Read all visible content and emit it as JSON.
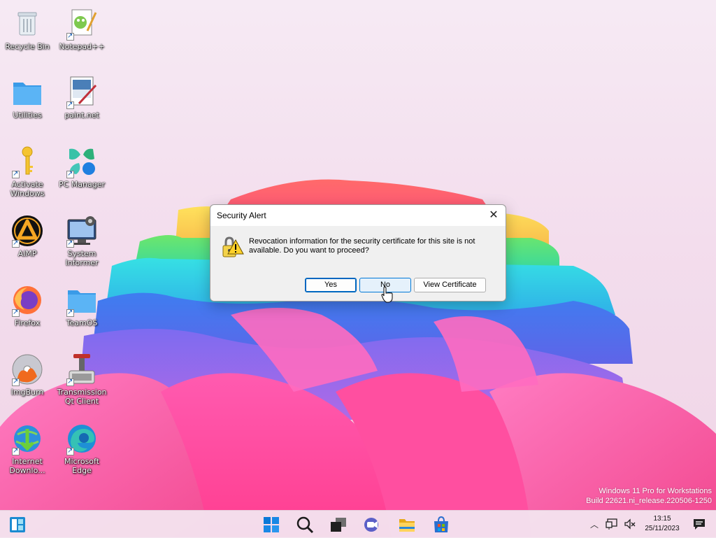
{
  "desktop": {
    "icons": [
      {
        "label": "Recycle Bin"
      },
      {
        "label": "Notepad++"
      },
      {
        "label": "Utilities"
      },
      {
        "label": "paint.net"
      },
      {
        "label": "Activate Windows"
      },
      {
        "label": "PC Manager"
      },
      {
        "label": "AIMP"
      },
      {
        "label": "System Informer"
      },
      {
        "label": "Firefox"
      },
      {
        "label": "TeamOS"
      },
      {
        "label": "ImgBurn"
      },
      {
        "label": "Transmission Qt Client"
      },
      {
        "label": "Internet Downlo..."
      },
      {
        "label": "Microsoft Edge"
      }
    ]
  },
  "dialog": {
    "title": "Security Alert",
    "message": "Revocation information for the security certificate for this site is not available. Do you want to proceed?",
    "buttons": {
      "yes": "Yes",
      "no": "No",
      "view_certificate": "View Certificate"
    },
    "icon": "lock-warning-icon"
  },
  "watermark": {
    "line1": "Windows 11 Pro for Workstations",
    "line2": "Build 22621.ni_release.220506-1250"
  },
  "taskbar": {
    "items": [
      "widgets-icon",
      "start-icon",
      "search-icon",
      "task-view-icon",
      "teams-chat-icon",
      "file-explorer-icon",
      "microsoft-store-icon"
    ],
    "tray": [
      "chevron-up-icon",
      "network-icon",
      "volume-muted-icon",
      "notification-icon"
    ],
    "time": "13:15",
    "date": "25/11/2023"
  },
  "colors": {
    "accent": "#0067c0",
    "taskbar_bg": "#f3e6f0"
  }
}
